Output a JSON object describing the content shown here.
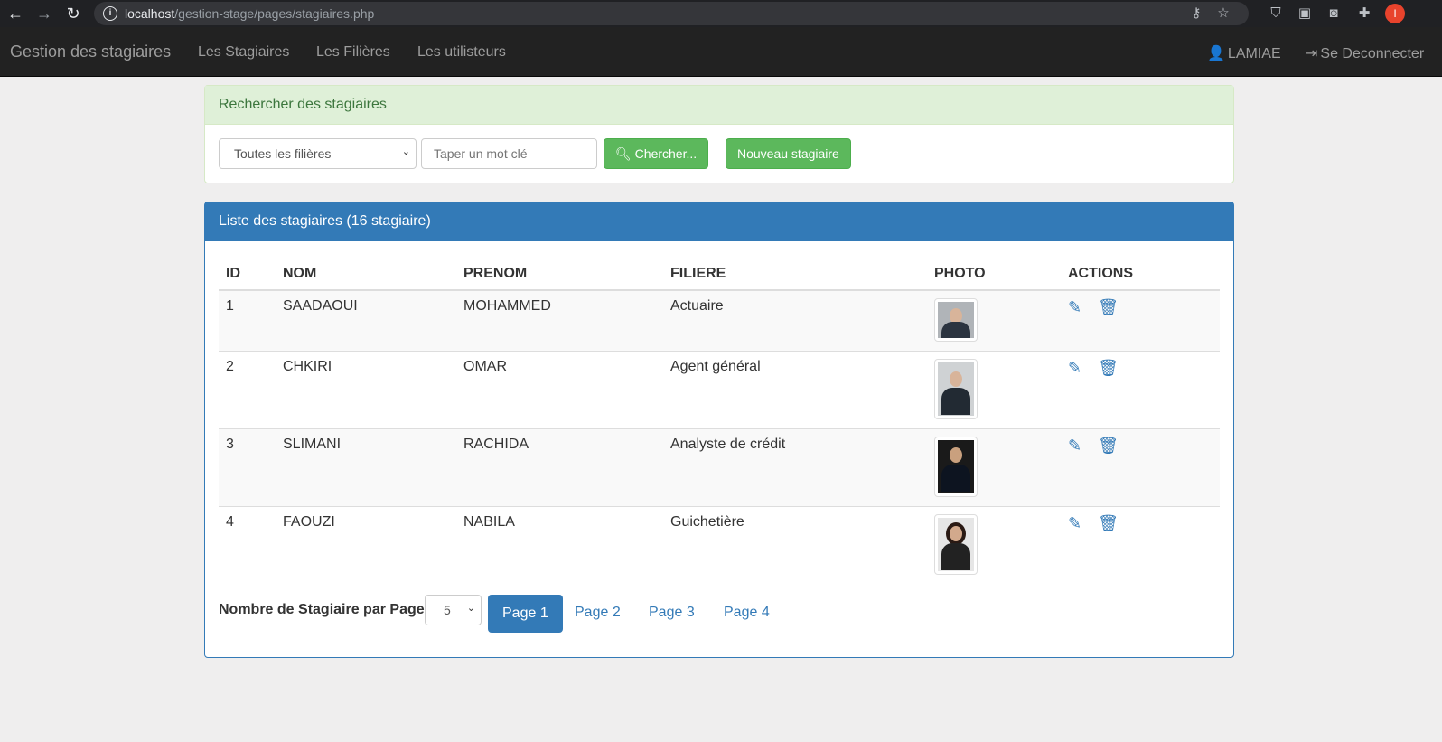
{
  "browser": {
    "url_host": "localhost",
    "url_path": "/gestion-stage/pages/stagiaires.php",
    "profile_initial": "I"
  },
  "navbar": {
    "brand": "Gestion des stagiaires",
    "links": [
      "Les Stagiaires",
      "Les Filières",
      "Les utilisteurs"
    ],
    "user": "LAMIAE",
    "logout": "Se Deconnecter"
  },
  "search": {
    "heading": "Rechercher des stagiaires",
    "filiere_selected": "Toutes les filières",
    "keyword_placeholder": "Taper un mot clé",
    "search_button": "Chercher...",
    "new_button": "Nouveau stagiaire"
  },
  "list": {
    "heading": "Liste des stagiaires (16   stagiaire)",
    "columns": [
      "ID",
      "NOM",
      "PRENOM",
      "FILIERE",
      "PHOTO",
      "ACTIONS"
    ],
    "rows": [
      {
        "id": "1",
        "nom": "SAADAOUI",
        "prenom": "MOHAMMED",
        "filiere": "Actuaire"
      },
      {
        "id": "2",
        "nom": "CHKIRI",
        "prenom": "OMAR",
        "filiere": "Agent général"
      },
      {
        "id": "3",
        "nom": "SLIMANI",
        "prenom": "RACHIDA",
        "filiere": "Analyste de crédit"
      },
      {
        "id": "4",
        "nom": "FAOUZI",
        "prenom": "NABILA",
        "filiere": "Guichetière"
      }
    ]
  },
  "pagination": {
    "label": "Nombre de Stagiaire par Page",
    "per_page": "5",
    "pages": [
      "Page 1",
      "Page 2",
      "Page 3",
      "Page 4"
    ],
    "active_page": "Page 1"
  },
  "colors": {
    "primary": "#337ab7",
    "success": "#5cb85c",
    "success_bg": "#dff0d8",
    "navbar": "#222222"
  }
}
